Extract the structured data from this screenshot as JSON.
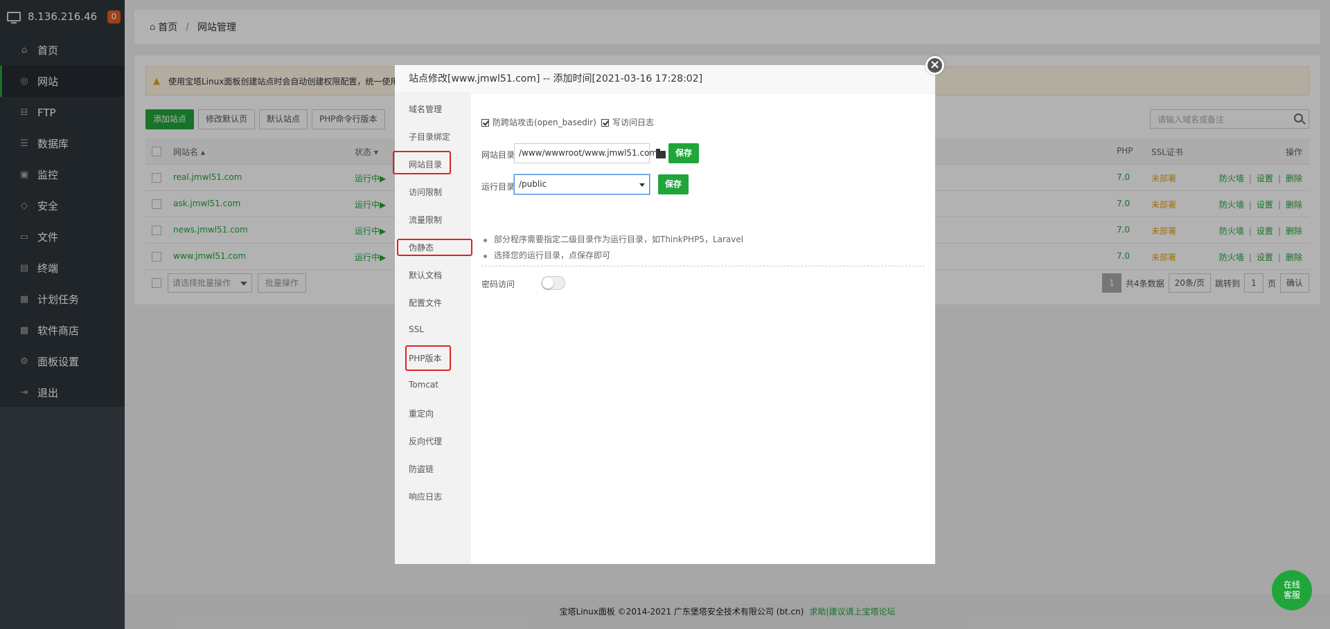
{
  "sidebar": {
    "server_ip": "8.136.216.46",
    "badge": "0",
    "items": [
      {
        "label": "首页",
        "icon": "home-icon"
      },
      {
        "label": "网站",
        "icon": "globe-icon"
      },
      {
        "label": "FTP",
        "icon": "ftp-icon"
      },
      {
        "label": "数据库",
        "icon": "database-icon"
      },
      {
        "label": "监控",
        "icon": "monitor-icon"
      },
      {
        "label": "安全",
        "icon": "shield-icon"
      },
      {
        "label": "文件",
        "icon": "folder-icon"
      },
      {
        "label": "终端",
        "icon": "terminal-icon"
      },
      {
        "label": "计划任务",
        "icon": "calendar-icon"
      },
      {
        "label": "软件商店",
        "icon": "grid-icon"
      },
      {
        "label": "面板设置",
        "icon": "gear-icon"
      },
      {
        "label": "退出",
        "icon": "logout-icon"
      }
    ]
  },
  "breadcrumb": {
    "home": "首页",
    "sep": "/",
    "current": "网站管理"
  },
  "notice": "使用宝塔Linux面板创建站点时会自动创建权限配置，统一使用",
  "toolbar": {
    "add": "添加站点",
    "default_page": "修改默认页",
    "default_site": "默认站点",
    "php_cli": "PHP命令行版本"
  },
  "search": {
    "placeholder": "请输入域名或备注"
  },
  "table": {
    "headers": {
      "name": "网站名 ▴",
      "status": "状态 ▾",
      "php": "PHP",
      "ssl": "SSL证书",
      "ops": "操作"
    },
    "rows": [
      {
        "name": "real.jmwl51.com",
        "status": "运行中▶",
        "php": "7.0",
        "ssl": "未部署"
      },
      {
        "name": "ask.jmwl51.com",
        "status": "运行中▶",
        "php": "7.0",
        "ssl": "未部署"
      },
      {
        "name": "news.jmwl51.com",
        "status": "运行中▶",
        "php": "7.0",
        "ssl": "未部署"
      },
      {
        "name": "www.jmwl51.com",
        "status": "运行中▶",
        "php": "7.0",
        "ssl": "未部署"
      }
    ],
    "ops": {
      "firewall": "防火墙",
      "settings": "设置",
      "delete": "删除",
      "sep": "|"
    }
  },
  "batch": {
    "select": "请选择批量操作",
    "button": "批量操作"
  },
  "pager": {
    "current": "1",
    "total": "共4条数据",
    "per_page": "20条/页",
    "jump": "跳转到",
    "page_input": "1",
    "page": "页",
    "confirm": "确认"
  },
  "footer": {
    "copyright": "宝塔Linux面板 ©2014-2021 广东堡塔安全技术有限公司 (bt.cn)",
    "link": "求助|建议请上宝塔论坛"
  },
  "help": {
    "line1": "在线",
    "line2": "客服"
  },
  "dialog": {
    "title": "站点修改[www.jmwl51.com] -- 添加时间[2021-03-16 17:28:02]",
    "close": "×",
    "nav": [
      "域名管理",
      "子目录绑定",
      "网站目录",
      "访问限制",
      "流量限制",
      "伪静态",
      "默认文档",
      "配置文件",
      "SSL",
      "PHP版本",
      "Tomcat",
      "重定向",
      "反向代理",
      "防盗链",
      "响应日志"
    ],
    "opt_basedir": "防跨站攻击(open_basedir)",
    "opt_log": "写访问日志",
    "site_dir_label": "网站目录",
    "site_dir_value": "/www/wwwroot/www.jmwl51.com",
    "run_dir_label": "运行目录",
    "run_dir_value": "/public",
    "save": "保存",
    "tip1": "部分程序需要指定二级目录作为运行目录，如ThinkPHP5，Laravel",
    "tip2": "选择您的运行目录，点保存即可",
    "password_label": "密码访问"
  }
}
